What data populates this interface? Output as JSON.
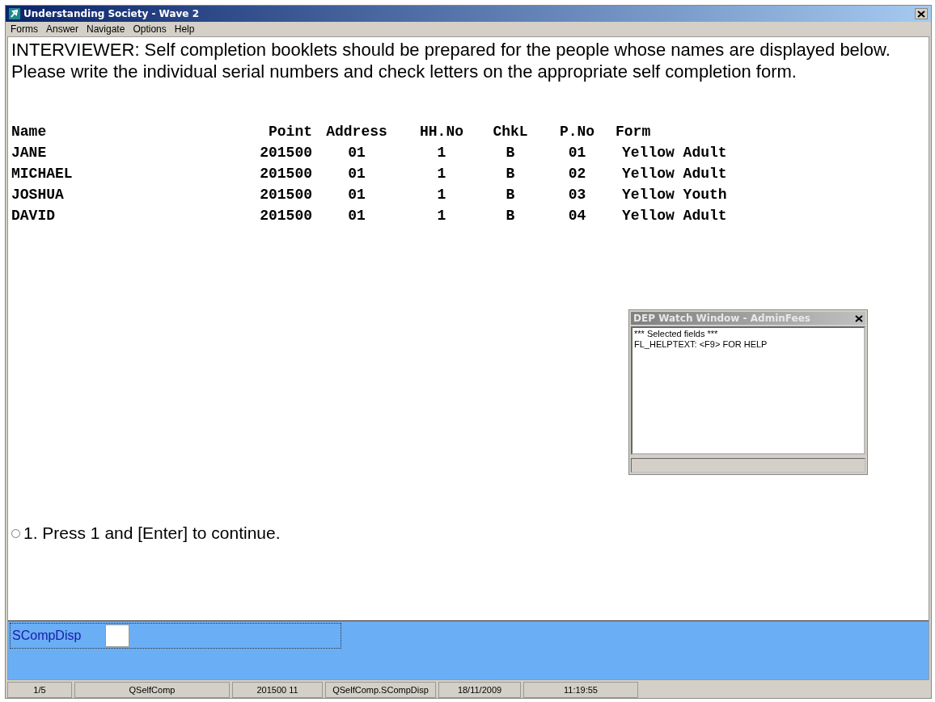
{
  "window": {
    "title": "Understanding Society - Wave 2"
  },
  "menu": [
    "Forms",
    "Answer",
    "Navigate",
    "Options",
    "Help"
  ],
  "question": "INTERVIEWER: Self completion booklets should be prepared for the people whose names are displayed below. Please write the individual serial numbers and check letters on the appropriate self completion form.",
  "table": {
    "columns": [
      "Name",
      "Point",
      "Address",
      "HH.No",
      "ChkL",
      "P.No",
      "Form"
    ],
    "rows": [
      [
        "JANE",
        "201500",
        "01",
        "1",
        "B",
        "01",
        "Yellow Adult"
      ],
      [
        "MICHAEL",
        "201500",
        "01",
        "1",
        "B",
        "02",
        "Yellow Adult"
      ],
      [
        "JOSHUA",
        "201500",
        "01",
        "1",
        "B",
        "03",
        "Yellow Youth"
      ],
      [
        "DAVID",
        "201500",
        "01",
        "1",
        "B",
        "04",
        "Yellow Adult"
      ]
    ]
  },
  "watch_window": {
    "title": "DEP Watch Window - AdminFees",
    "lines": [
      "*** Selected fields ***",
      "FL_HELPTEXT: <F9> FOR HELP"
    ]
  },
  "options": [
    {
      "label": "1. Press 1 and [Enter] to continue.",
      "selected": false
    }
  ],
  "answer": {
    "label": "SCompDisp"
  },
  "status_bar": [
    "1/5",
    "QSelfComp",
    "201500 11",
    "QSelfComp.SCompDisp",
    "18/11/2009",
    "11:19:55"
  ]
}
